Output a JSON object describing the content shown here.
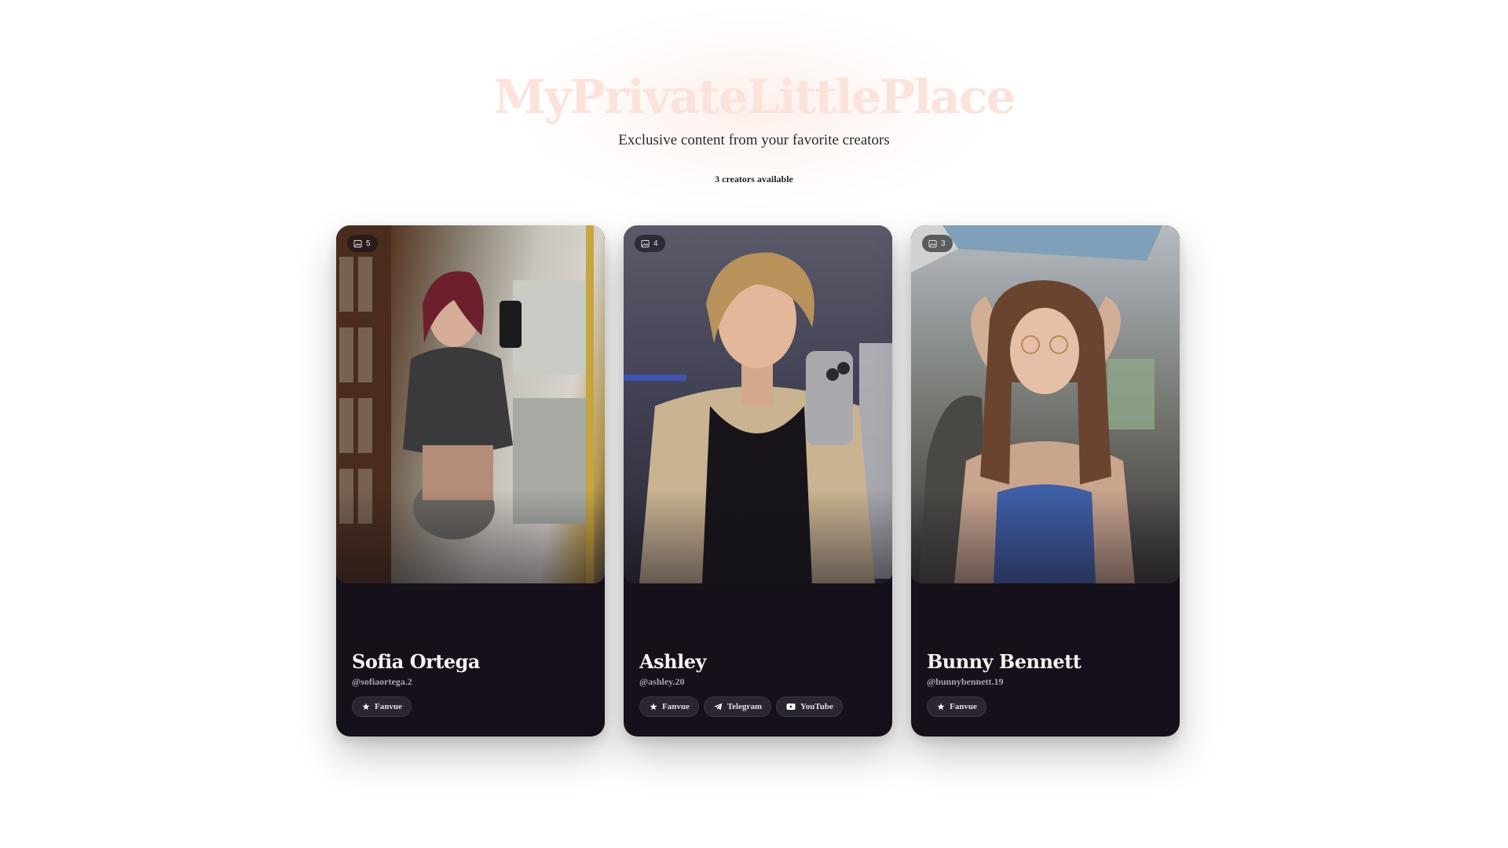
{
  "site": {
    "title": "MyPrivateLittlePlace",
    "tagline": "Exclusive content from your favorite creators",
    "creator_count": "3 creators available"
  },
  "colors": {
    "card_bg": "#15101a",
    "title_tint": "#fbe3dc",
    "pill_bg": "#2a2530"
  },
  "creators": [
    {
      "name": "Sofia Ortega",
      "handle": "@sofiaortega.2",
      "media_count": "5",
      "media_icon": "image-icon",
      "links": [
        {
          "label": "Fanvue",
          "icon": "star-icon"
        }
      ]
    },
    {
      "name": "Ashley",
      "handle": "@ashley.20",
      "media_count": "4",
      "media_icon": "image-icon",
      "links": [
        {
          "label": "Fanvue",
          "icon": "star-icon"
        },
        {
          "label": "Telegram",
          "icon": "telegram-icon"
        },
        {
          "label": "YouTube",
          "icon": "youtube-icon"
        }
      ]
    },
    {
      "name": "Bunny Bennett",
      "handle": "@bunnybennett.19",
      "media_count": "3",
      "media_icon": "image-icon",
      "links": [
        {
          "label": "Fanvue",
          "icon": "star-icon"
        }
      ]
    }
  ]
}
